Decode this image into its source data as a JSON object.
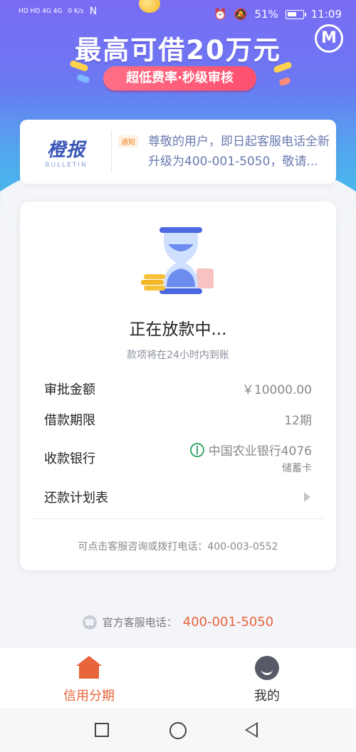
{
  "statusbar": {
    "net_left": "HD HD 4G 4G",
    "speed": "0 K/s",
    "nfc": "N",
    "battery": "51%",
    "time": "11:09"
  },
  "banner": {
    "title": "最高可借20万元",
    "badge": "超低费率·秒级审核",
    "logo_letter": "M"
  },
  "notice": {
    "brand_cn": "橙报",
    "brand_en": "BULLETIN",
    "tag": "通知",
    "text": "尊敬的用户，即日起客服电话全新升级为400-001-5050，敬请..."
  },
  "status": {
    "title": "正在放款中...",
    "subtitle": "款项将在24小时内到账"
  },
  "details": {
    "amount_label": "审批金额",
    "amount_value": "￥10000.00",
    "term_label": "借款期限",
    "term_value": "12期",
    "bank_label": "收款银行",
    "bank_name": "中国农业银行4076",
    "bank_card_type": "储蓄卡",
    "plan_label": "还款计划表"
  },
  "contact": {
    "text": "可点击客服咨询或拨打电话：400-003-0552"
  },
  "hotline": {
    "label": "官方客服电话：",
    "number": "400-001-5050"
  },
  "tabbar": {
    "tab1": "信用分期",
    "tab2": "我的"
  },
  "colors": {
    "accent": "#e8643c",
    "banner_top": "#7a6cf5",
    "banner_bottom": "#3fc6ea"
  }
}
